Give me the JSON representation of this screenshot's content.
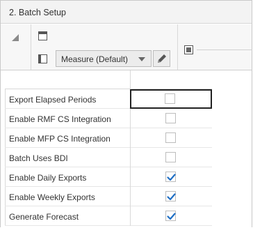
{
  "panel": {
    "title": "2. Batch Setup"
  },
  "header": {
    "measure_select": {
      "selected": "Measure (Default)"
    }
  },
  "icons": {
    "corner": "collapse-triangle-icon",
    "rows": "row-dimension-icon",
    "columns": "column-dimension-icon",
    "edit": "pencil-icon",
    "grid": "grid-dimension-icon",
    "checkmark": "checkmark-icon"
  },
  "colors": {
    "check": "#1f6fc5",
    "focus_border": "#222222"
  },
  "rows": [
    {
      "label": "Export Elapsed Periods",
      "checked": false,
      "focused": true
    },
    {
      "label": "Enable RMF CS Integration",
      "checked": false,
      "focused": false
    },
    {
      "label": "Enable MFP CS Integration",
      "checked": false,
      "focused": false
    },
    {
      "label": "Batch Uses BDI",
      "checked": false,
      "focused": false
    },
    {
      "label": "Enable Daily Exports",
      "checked": true,
      "focused": false
    },
    {
      "label": "Enable Weekly Exports",
      "checked": true,
      "focused": false
    },
    {
      "label": "Generate Forecast",
      "checked": true,
      "focused": false
    }
  ]
}
